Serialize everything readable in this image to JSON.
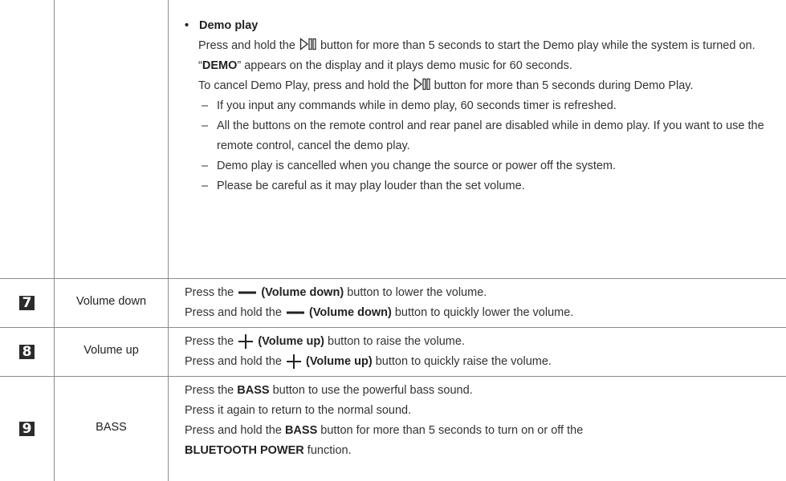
{
  "demo": {
    "title": "Demo play",
    "p1_a": "Press and hold the",
    "p1_b": "button for more than 5 seconds to start the Demo play while the system is turned on. “",
    "p1_bold": "DEMO",
    "p1_c": "” appears on the display and it plays demo music for 60 seconds.",
    "p2_a": "To cancel Demo Play, press and hold the",
    "p2_b": "button for more than 5 seconds during Demo Play.",
    "dash": "–",
    "notes": [
      "If you input any commands while in demo play, 60 seconds timer is refreshed.",
      "All the buttons on the remote control and rear panel are disabled while in demo play. If you want to use the remote control, cancel the demo play.",
      "Demo play is cancelled when you change the source or power off the system.",
      "Please be careful as it may play louder than the set volume."
    ]
  },
  "rows": [
    {
      "number": "7",
      "name": "Volume down",
      "l1_a": "Press the",
      "l1_bold": "(Volume down)",
      "l1_b": "button to lower the volume.",
      "l2_a": "Press and hold the",
      "l2_bold": "(Volume down)",
      "l2_b": "button to quickly lower the volume."
    },
    {
      "number": "8",
      "name": "Volume up",
      "l1_a": "Press the",
      "l1_bold": "(Volume up)",
      "l1_b": "button to raise the volume.",
      "l2_a": "Press and hold the",
      "l2_bold": "(Volume up)",
      "l2_b": "button to quickly raise the volume."
    },
    {
      "number": "9",
      "name": "BASS",
      "l1_a": "Press the",
      "l1_bold": "BASS",
      "l1_b": "button to use the powerful bass sound.",
      "l2": "Press it again to return to the normal sound.",
      "l3_a": "Press and hold the",
      "l3_bold": "BASS",
      "l3_b": "button for more than 5 seconds to turn on or off the",
      "l4_bold": "BLUETOOTH POWER",
      "l4_b": "function."
    }
  ],
  "icons": [
    "play-pause-icon",
    "minus-icon",
    "plus-icon"
  ]
}
